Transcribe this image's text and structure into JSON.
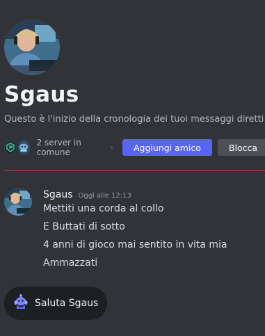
{
  "profile": {
    "name": "Sgaus",
    "intro": "Questo è l'inizio della cronologia dei tuoi messaggi diretti con Sgaus."
  },
  "mutual": {
    "server_count_text": "2 server in comune"
  },
  "actions": {
    "add_friend_label": "Aggiungi amico",
    "block_label": "Blocca"
  },
  "message": {
    "author": "Sgaus",
    "timestamp": "Oggi alle 12:13",
    "lines": [
      "Mettiti una corda al collo",
      "E Buttati di sotto",
      "4 anni di gioco mai sentito in vita mia",
      "Ammazzati"
    ]
  },
  "wave_button": {
    "label": "Saluta Sgaus"
  },
  "colors": {
    "background": "#313338",
    "accent": "#5865f2",
    "divider": "#f23f43",
    "secondary_button": "#4e5058",
    "wave_background": "#1e1f22"
  }
}
